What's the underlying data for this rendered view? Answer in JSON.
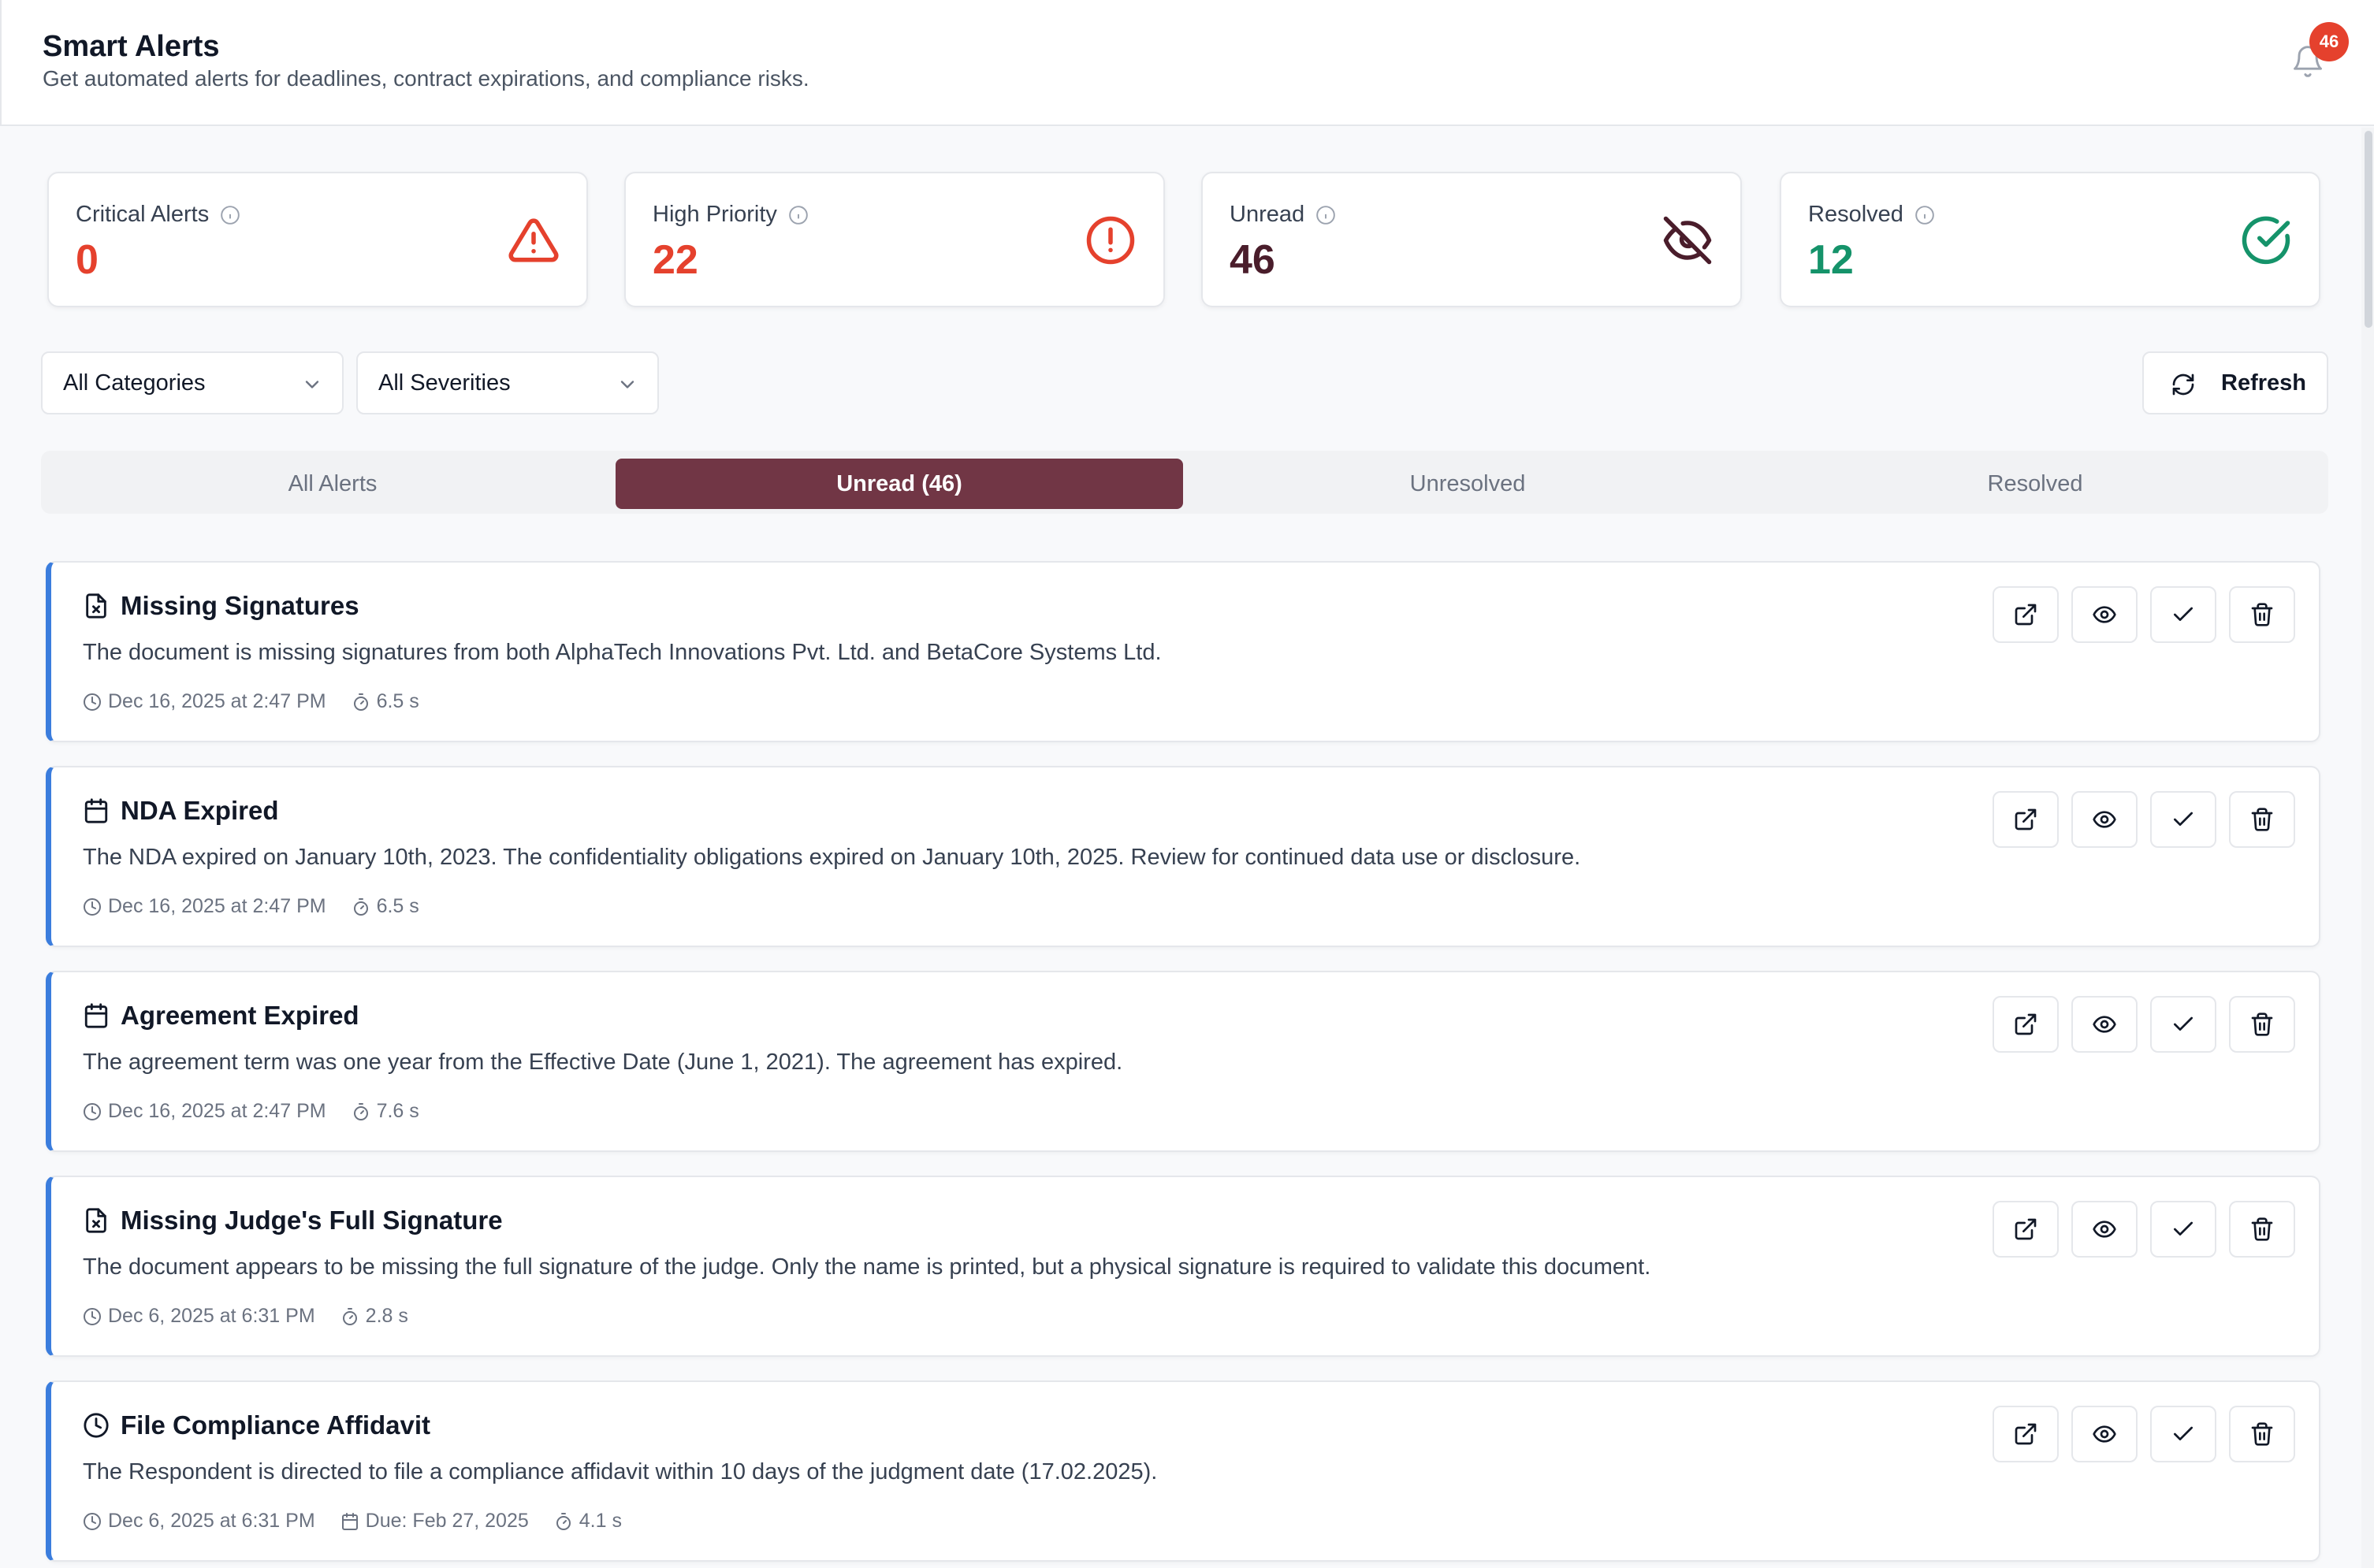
{
  "header": {
    "title": "Smart Alerts",
    "subtitle": "Get automated alerts for deadlines, contract expirations, and compliance risks.",
    "notification_count": "46",
    "bell_icon": "bell-icon"
  },
  "stats": [
    {
      "label": "Critical Alerts",
      "value": "0",
      "color": "#e5412d",
      "icon": "warning-triangle-icon"
    },
    {
      "label": "High Priority",
      "value": "22",
      "color": "#e5412d",
      "icon": "alert-circle-icon"
    },
    {
      "label": "Unread",
      "value": "46",
      "color": "#4a1d2b",
      "icon": "eye-off-icon"
    },
    {
      "label": "Resolved",
      "value": "12",
      "color": "#15936a",
      "icon": "check-circle-icon"
    }
  ],
  "filters": {
    "category": "All Categories",
    "severity": "All Severities",
    "refresh_label": "Refresh"
  },
  "tabs": [
    {
      "label": "All Alerts",
      "active": false
    },
    {
      "label": "Unread (46)",
      "active": true
    },
    {
      "label": "Unresolved",
      "active": false
    },
    {
      "label": "Resolved",
      "active": false
    }
  ],
  "alerts": [
    {
      "icon": "file-x-icon",
      "title": "Missing Signatures",
      "description": "The document is missing signatures from both AlphaTech Innovations Pvt. Ltd. and BetaCore Systems Ltd.",
      "date": "Dec 16, 2025 at 2:47 PM",
      "duration": "6.5 s"
    },
    {
      "icon": "calendar-icon",
      "title": "NDA Expired",
      "description": "The NDA expired on January 10th, 2023. The confidentiality obligations expired on January 10th, 2025. Review for continued data use or disclosure.",
      "date": "Dec 16, 2025 at 2:47 PM",
      "duration": "6.5 s"
    },
    {
      "icon": "calendar-icon",
      "title": "Agreement Expired",
      "description": "The agreement term was one year from the Effective Date (June 1, 2021). The agreement has expired.",
      "date": "Dec 16, 2025 at 2:47 PM",
      "duration": "7.6 s"
    },
    {
      "icon": "file-x-icon",
      "title": "Missing Judge's Full Signature",
      "description": "The document appears to be missing the full signature of the judge. Only the name is printed, but a physical signature is required to validate this document.",
      "date": "Dec 6, 2025 at 6:31 PM",
      "duration": "2.8 s"
    },
    {
      "icon": "clock-icon",
      "title": "File Compliance Affidavit",
      "description": "The Respondent is directed to file a compliance affidavit within 10 days of the judgment date (17.02.2025).",
      "date": "Dec 6, 2025 at 6:31 PM",
      "due": "Due: Feb 27, 2025",
      "duration": "4.1 s"
    }
  ]
}
